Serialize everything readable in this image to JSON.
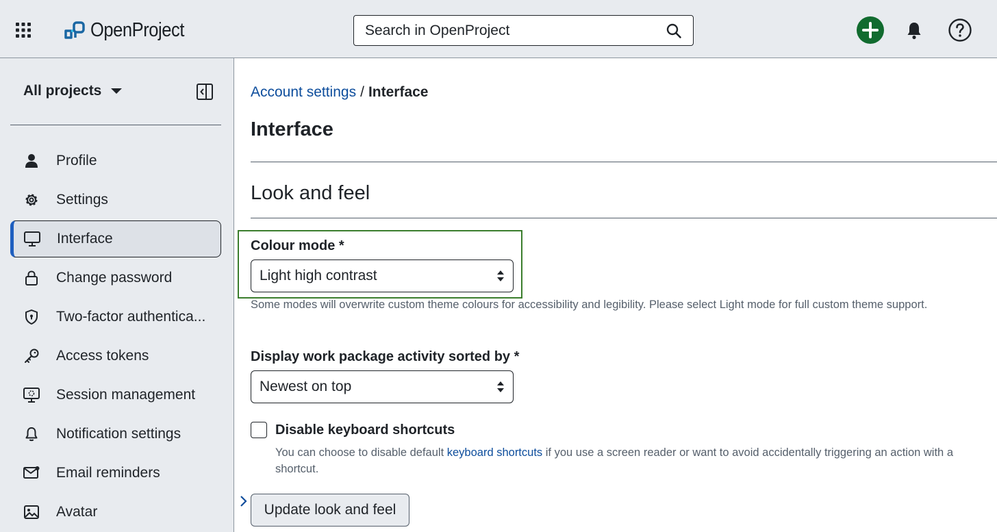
{
  "header": {
    "logo_text": "OpenProject",
    "search": {
      "placeholder": "Search in OpenProject"
    },
    "icons": [
      "grid-icon",
      "search-icon",
      "plus-icon",
      "bell-icon",
      "help-icon"
    ],
    "accent_color": "#116b2f"
  },
  "sidebar": {
    "project_selector": "All projects",
    "items": [
      {
        "label": "Profile",
        "icon": "user-icon",
        "active": false
      },
      {
        "label": "Settings",
        "icon": "gear-icon",
        "active": false
      },
      {
        "label": "Interface",
        "icon": "monitor-icon",
        "active": true
      },
      {
        "label": "Change password",
        "icon": "lock-icon",
        "active": false
      },
      {
        "label": "Two-factor authentica...",
        "icon": "shield-icon",
        "active": false
      },
      {
        "label": "Access tokens",
        "icon": "key-icon",
        "active": false
      },
      {
        "label": "Session management",
        "icon": "session-icon",
        "active": false
      },
      {
        "label": "Notification settings",
        "icon": "bell-icon",
        "active": false
      },
      {
        "label": "Email reminders",
        "icon": "mail-icon",
        "active": false
      },
      {
        "label": "Avatar",
        "icon": "image-icon",
        "active": false
      }
    ]
  },
  "main": {
    "breadcrumb": {
      "parent": "Account settings",
      "separator": "/",
      "current": "Interface"
    },
    "page_title": "Interface",
    "section_title": "Look and feel",
    "colour_mode": {
      "label": "Colour mode *",
      "value": "Light high contrast",
      "help": "Some modes will overwrite custom theme colours for accessibility and legibility. Please select Light mode for full custom theme support."
    },
    "activity_sort": {
      "label": "Display work package activity sorted by *",
      "value": "Newest on top"
    },
    "keyboard_shortcuts": {
      "label": "Disable keyboard shortcuts",
      "checked": false,
      "help_before": "You can choose to disable default ",
      "help_link": "keyboard shortcuts",
      "help_after": " if you use a screen reader or want to avoid accidentally triggering an action with a shortcut."
    },
    "submit_label": "Update look and feel",
    "highlight_color": "#3a7d2c",
    "link_color": "#0d4d9c"
  }
}
